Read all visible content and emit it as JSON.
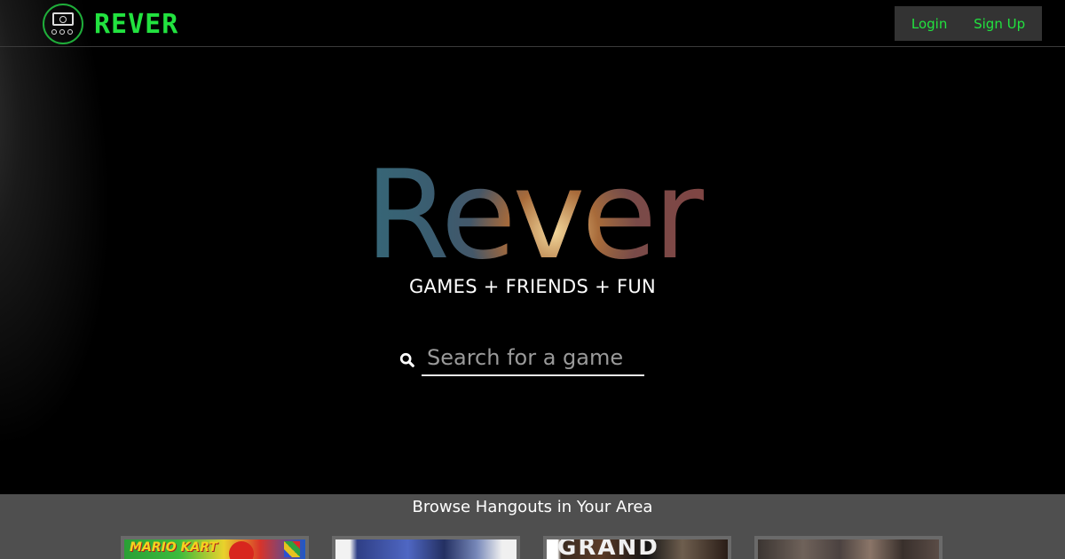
{
  "brand": {
    "name": "REVER",
    "accent_color": "#22e23f"
  },
  "header": {
    "login_label": "Login",
    "signup_label": "Sign Up"
  },
  "hero": {
    "title": "Rever",
    "tagline": "GAMES + FRIENDS + FUN",
    "search": {
      "placeholder": "Search for a game",
      "value": "",
      "icon": "search-icon"
    }
  },
  "browse": {
    "title": "Browse Hangouts in Your Area",
    "cards": [
      {
        "text": "MARIO KART"
      },
      {
        "text": ""
      },
      {
        "text": "GRAND"
      },
      {
        "text": ""
      }
    ]
  }
}
